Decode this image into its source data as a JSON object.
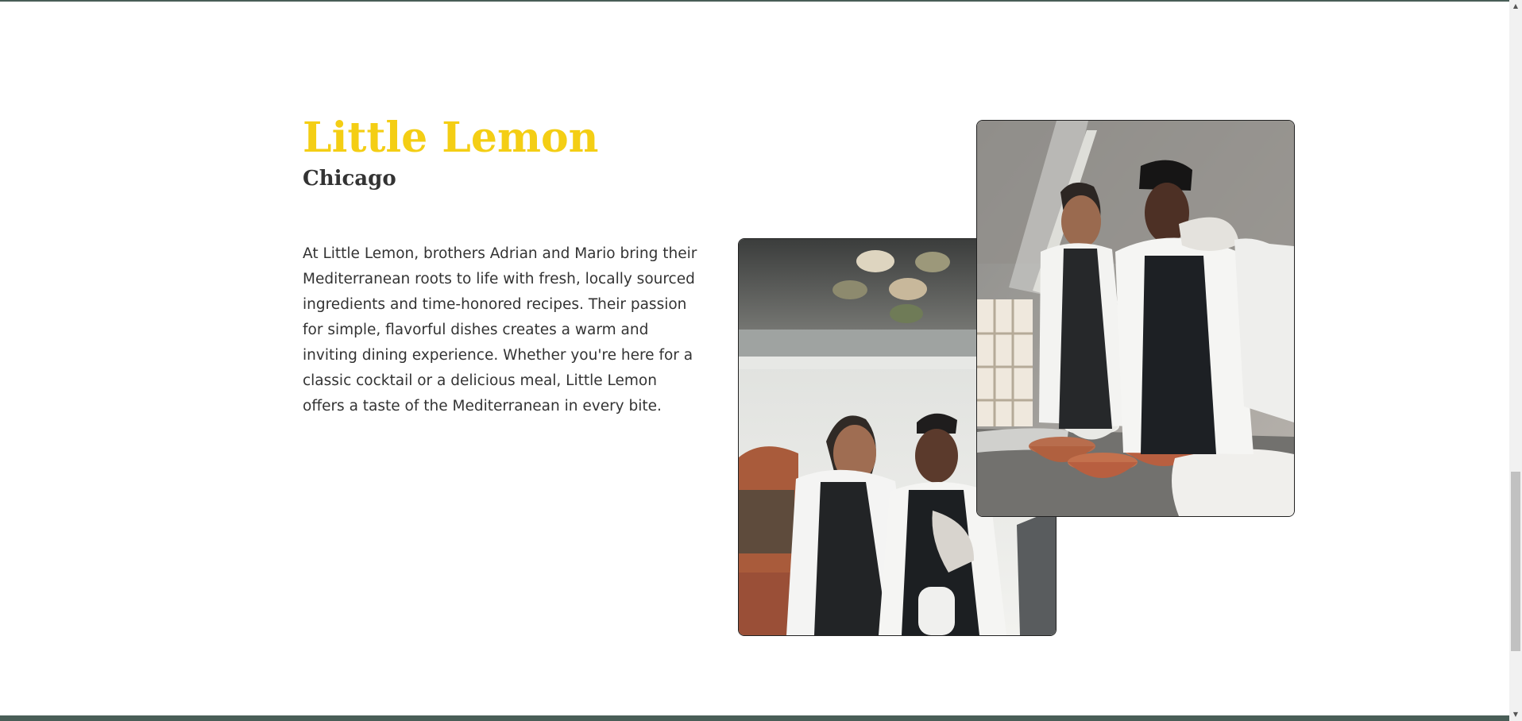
{
  "about": {
    "title": "Little Lemon",
    "subtitle": "Chicago",
    "description": "At Little Lemon, brothers Adrian and Mario bring their Mediterranean roots to life with fresh, locally sourced ingredients and time-honored recipes. Their passion for simple, flavorful dishes creates a warm and inviting dining experience. Whether you're here for a classic cocktail or a delicious meal, Little Lemon offers a taste of the Mediterranean in every bite."
  },
  "images": [
    {
      "name": "chefs-laughing-photo"
    },
    {
      "name": "chefs-talking-photo"
    }
  ],
  "scrollbar": {
    "up_arrow": "▲",
    "down_arrow": "▼"
  },
  "colors": {
    "accent_yellow": "#f4ce14",
    "brand_green": "#495e57",
    "text_dark": "#333333"
  }
}
